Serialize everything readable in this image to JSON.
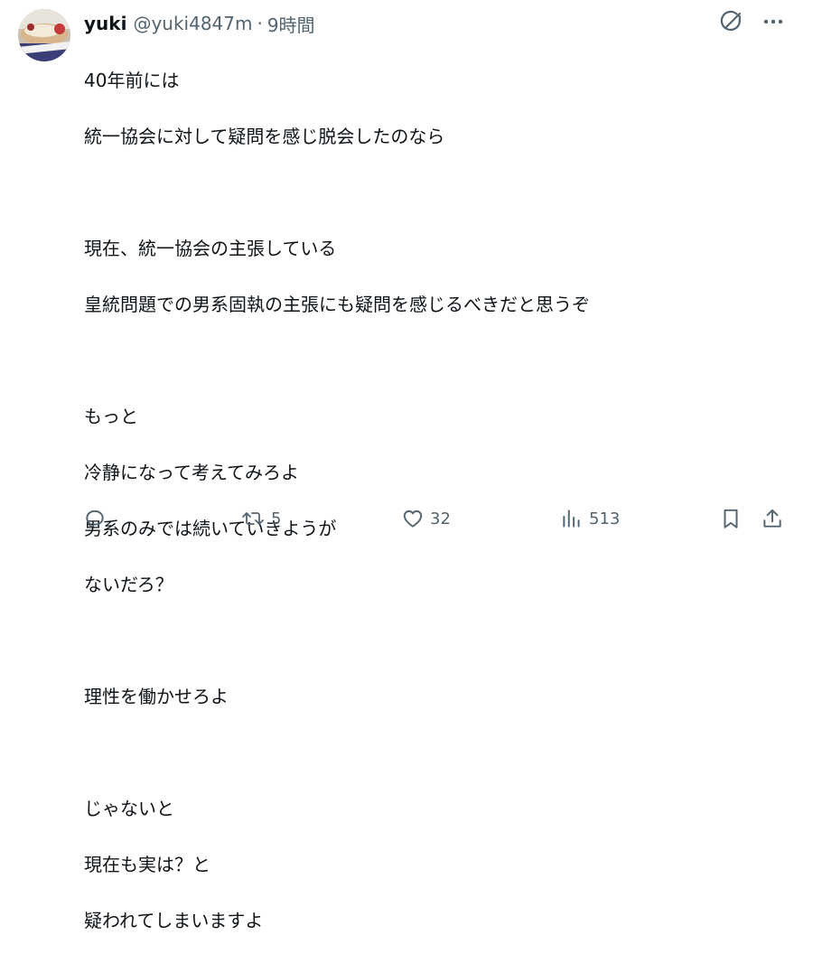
{
  "author": {
    "display_name": "yuki",
    "handle": "@yuki4847m",
    "separator": "·",
    "time": "9時間"
  },
  "tweet": {
    "lines": [
      "40年前には",
      "統一協会に対して疑問を感じ脱会したのなら",
      "",
      "現在、統一協会の主張している",
      "皇統問題での男系固執の主張にも疑問を感じるべきだと思うぞ",
      "",
      "もっと",
      "冷静になって考えてみろよ",
      "男系のみでは続いていきようが",
      "ないだろ？",
      "",
      "理性を働かせろよ",
      "",
      "じゃないと",
      "現在も実は？と",
      "疑われてしまいますよ"
    ]
  },
  "actions": {
    "reply_count": "",
    "retweet_count": "5",
    "like_count": "32",
    "views_count": "513"
  },
  "icons": {
    "grok": "grok-icon",
    "more": "more-icon",
    "reply": "reply-icon",
    "retweet": "retweet-icon",
    "like": "heart-icon",
    "views": "views-icon",
    "bookmark": "bookmark-icon",
    "share": "share-icon"
  },
  "colors": {
    "text": "#0f1419",
    "secondary": "#536471"
  }
}
